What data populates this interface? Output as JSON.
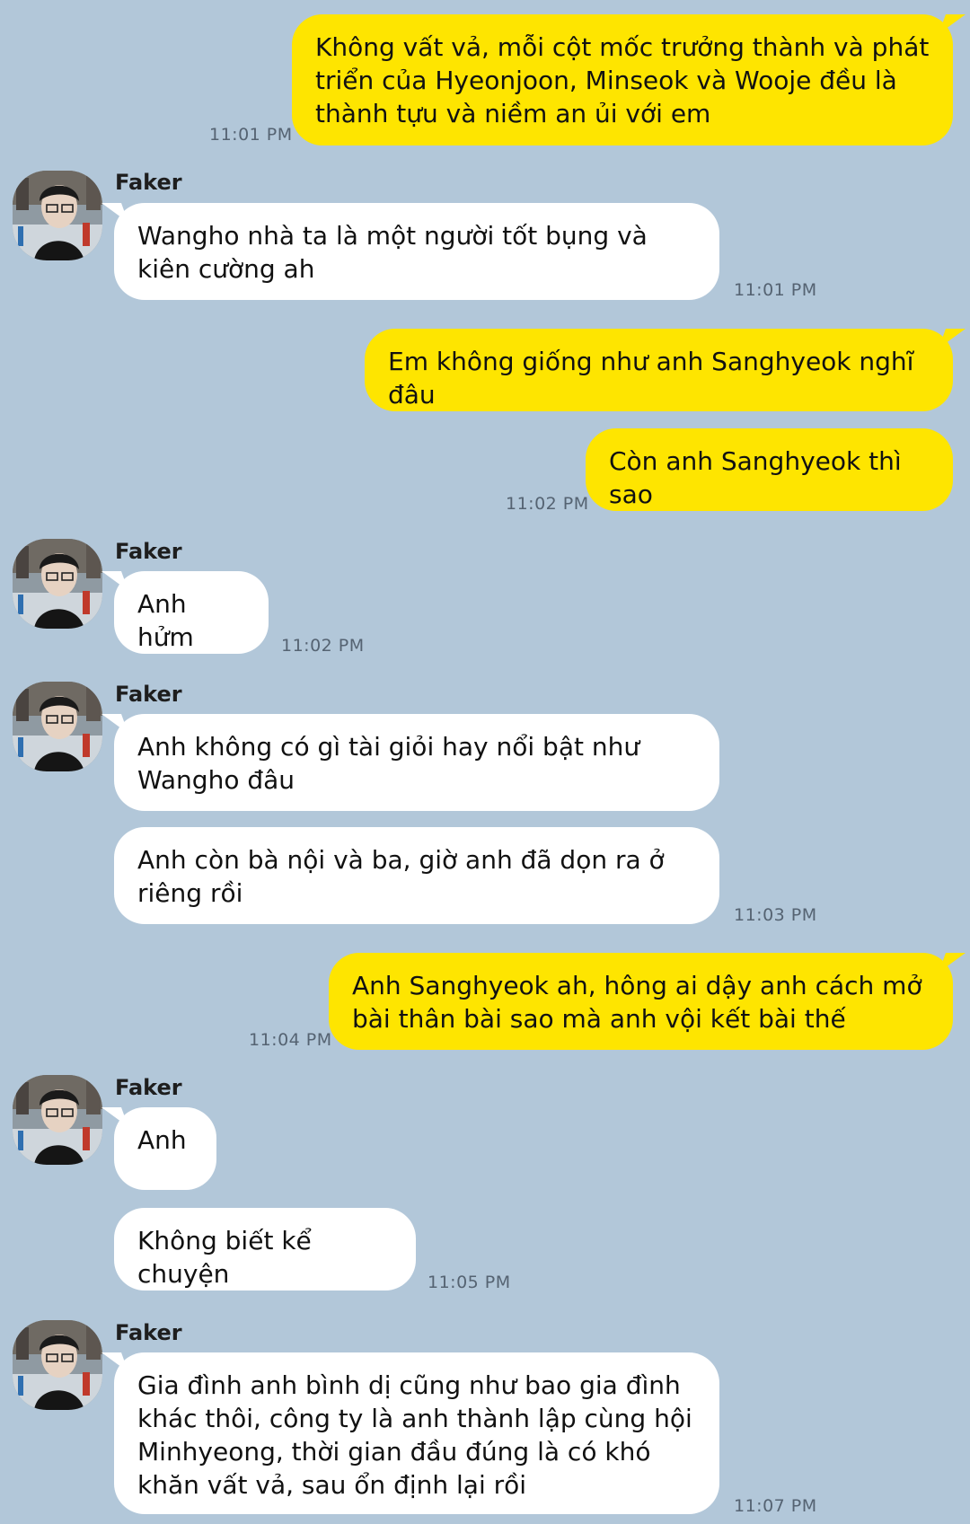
{
  "contact": {
    "name": "Faker"
  },
  "messages": {
    "m1": {
      "text": "Không vất vả, mỗi cột mốc trưởng thành và phát triển của Hyeonjoon, Minseok và Wooje đều là thành tựu và niềm an ủi với em",
      "time": "11:01 PM"
    },
    "m2": {
      "text": "Wangho nhà ta là một người tốt bụng và kiên cường ah",
      "time": "11:01 PM"
    },
    "m3": {
      "text": "Em không giống như anh Sanghyeok nghĩ đâu"
    },
    "m4": {
      "text": "Còn anh Sanghyeok thì sao",
      "time": "11:02 PM"
    },
    "m5": {
      "text": "Anh hửm",
      "time": "11:02 PM"
    },
    "m6": {
      "text": "Anh không có gì tài giỏi hay nổi bật như Wangho đâu"
    },
    "m7": {
      "text": "Anh còn bà nội và ba, giờ anh đã dọn ra ở riêng rồi",
      "time": "11:03 PM"
    },
    "m8": {
      "text": "Anh Sanghyeok ah, hông ai dậy anh cách mở bài thân bài sao mà anh vội kết bài thế",
      "time": "11:04 PM"
    },
    "m9": {
      "text": "Anh"
    },
    "m10": {
      "text": "Không biết kể chuyện",
      "time": "11:05 PM"
    },
    "m11": {
      "text": "Gia đình anh bình dị cũng như bao gia đình khác thôi, công ty là anh thành lập cùng hội Minhyeong, thời gian đầu đúng là có khó khăn vất vả, sau ổn định lại rồi",
      "time": "11:07 PM"
    }
  },
  "colors": {
    "background": "#b2c7d9",
    "outgoing": "#fee500",
    "incoming": "#ffffff"
  }
}
